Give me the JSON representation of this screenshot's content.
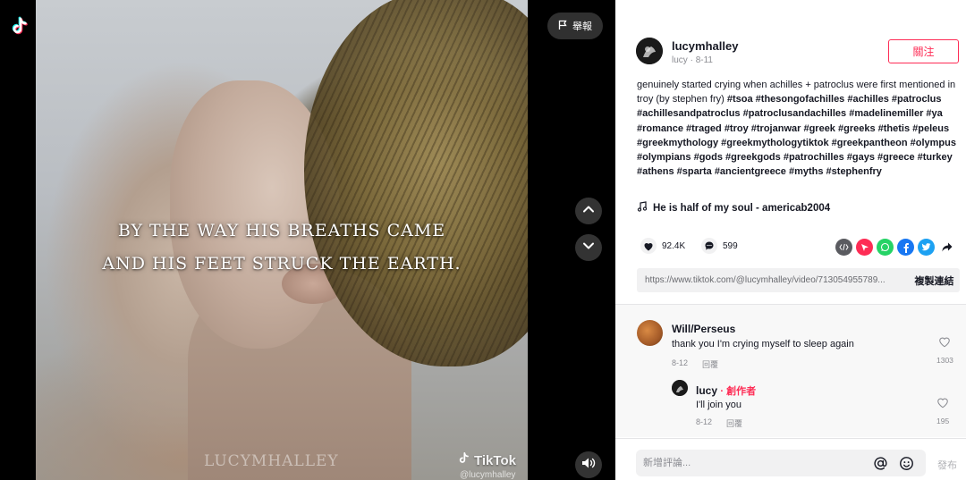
{
  "video": {
    "overlay_line1": "BY THE WAY HIS BREATHS CAME",
    "overlay_line2": "AND HIS FEET STRUCK THE EARTH.",
    "watermark_name": "LUCYMHALLEY",
    "tiktok_watermark": "TikTok",
    "tiktok_handle": "@lucymhalley",
    "report_label": "舉報"
  },
  "author": {
    "username": "lucymhalley",
    "nickname": "lucy",
    "date": "8-11",
    "follow_label": "關注"
  },
  "caption": {
    "text": "genuinely started crying when achilles + patroclus were first mentioned in troy (by stephen fry) ",
    "hashtags": "#tsoa #thesongofachilles #achilles #patroclus #achillesandpatroclus #patroclusandachilles #madelinemiller #ya #romance #traged #troy #trojanwar #greek #greeks #thetis #peleus #greekmythology #greekmythologytiktok #greekpantheon #olympus #olympians #gods #greekgods #patrochilles #gays #greece #turkey #athens #sparta #ancientgreece #myths #stephenfry"
  },
  "music": {
    "title": "He is half of my soul - americab2004"
  },
  "stats": {
    "likes": "92.4K",
    "comments": "599"
  },
  "share": {
    "link": "https://www.tiktok.com/@lucymhalley/video/713054955789...",
    "copy_label": "複製連結",
    "embed_icon": "embed-icon",
    "colors": {
      "embed": "#5a5b60",
      "direct": "#fe2c55",
      "whatsapp": "#25d366",
      "facebook": "#1877f2",
      "twitter": "#1da1f2"
    }
  },
  "comments": [
    {
      "name": "Will/Perseus",
      "text": "thank you I'm crying myself to sleep again",
      "date": "8-12",
      "reply_label": "回覆",
      "likes": "1303"
    },
    {
      "name": "lucy",
      "creator_badge": "· 創作者",
      "text": "I'll join you",
      "date": "8-12",
      "reply_label": "回覆",
      "likes": "195"
    }
  ],
  "composer": {
    "placeholder": "新增評論...",
    "post_label": "發布"
  },
  "colors": {
    "accent": "#fe2c55",
    "text": "#161823",
    "muted": "#8a8b91"
  }
}
